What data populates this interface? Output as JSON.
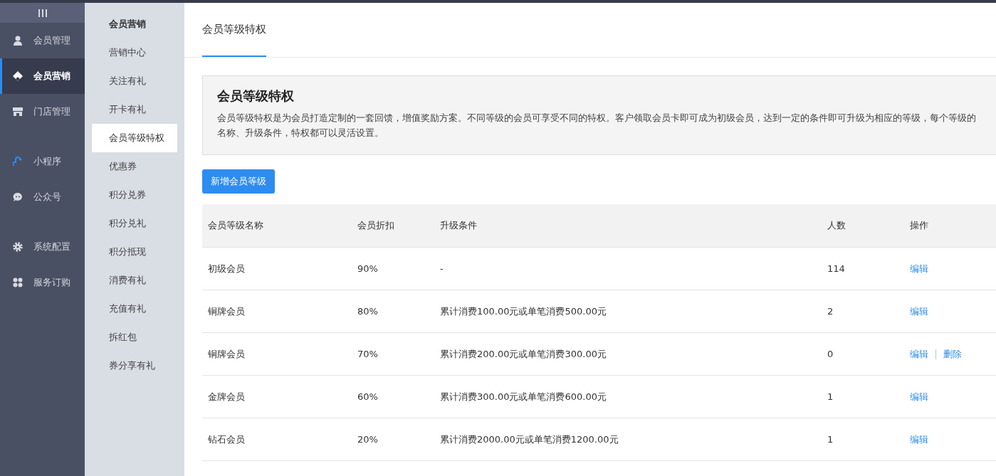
{
  "main_nav": {
    "groups": [
      [
        {
          "label": "会员管理",
          "selected": false
        },
        {
          "label": "会员营销",
          "selected": true
        },
        {
          "label": "门店管理",
          "selected": false
        }
      ],
      [
        {
          "label": "小程序",
          "selected": false
        },
        {
          "label": "公众号",
          "selected": false
        }
      ],
      [
        {
          "label": "系统配置",
          "selected": false
        },
        {
          "label": "服务订购",
          "selected": false
        }
      ]
    ]
  },
  "sub_nav": {
    "heading": "会员营销",
    "items": [
      {
        "label": "营销中心",
        "selected": false
      },
      {
        "label": "关注有礼",
        "selected": false
      },
      {
        "label": "开卡有礼",
        "selected": false
      },
      {
        "label": "会员等级特权",
        "selected": true
      },
      {
        "label": "优惠券",
        "selected": false
      },
      {
        "label": "积分兑券",
        "selected": false
      },
      {
        "label": "积分兑礼",
        "selected": false
      },
      {
        "label": "积分抵现",
        "selected": false
      },
      {
        "label": "消费有礼",
        "selected": false
      },
      {
        "label": "充值有礼",
        "selected": false
      },
      {
        "label": "拆红包",
        "selected": false
      },
      {
        "label": "券分享有礼",
        "selected": false
      }
    ]
  },
  "tabs": [
    {
      "label": "会员等级特权",
      "selected": true
    }
  ],
  "info": {
    "title": "会员等级特权",
    "text": "会员等级特权是为会员打造定制的一套回馈，增值奖励方案。不同等级的会员可享受不同的特权。客户领取会员卡即可成为初级会员，达到一定的条件即可升级为相应的等级，每个等级的名称、升级条件，特权都可以灵活设置。"
  },
  "add_button": "新增会员等级",
  "table": {
    "columns": [
      "会员等级名称",
      "会员折扣",
      "升级条件",
      "人数",
      "操作"
    ],
    "rows": [
      {
        "cells": [
          "初级会员",
          "90%",
          "-",
          "114"
        ],
        "actions": [
          "编辑"
        ]
      },
      {
        "cells": [
          "铜牌会员",
          "80%",
          "累计消费100.00元或单笔消费500.00元",
          "2"
        ],
        "actions": [
          "编辑"
        ]
      },
      {
        "cells": [
          "铜牌会员",
          "70%",
          "累计消费200.00元或单笔消费300.00元",
          "0"
        ],
        "actions": [
          "编辑",
          "删除"
        ]
      },
      {
        "cells": [
          "金牌会员",
          "60%",
          "累计消费300.00元或单笔消费600.00元",
          "1"
        ],
        "actions": [
          "编辑"
        ]
      },
      {
        "cells": [
          "钻石会员",
          "20%",
          "累计消费2000.00元或单笔消费1200.00元",
          "1"
        ],
        "actions": [
          "编辑"
        ]
      }
    ]
  }
}
